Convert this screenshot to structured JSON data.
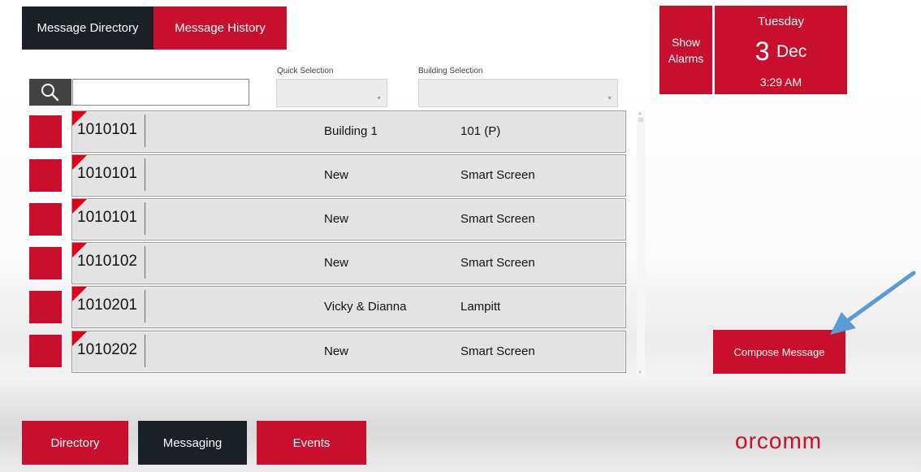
{
  "top_tabs": {
    "message_directory": "Message Directory",
    "message_history": "Message History"
  },
  "filters": {
    "quick_selection_label": "Quick Selection",
    "building_selection_label": "Building Selection",
    "search_value": ""
  },
  "rows": [
    {
      "id": "1010101",
      "col1": "Building 1",
      "col2": "101 (P)"
    },
    {
      "id": "1010101",
      "col1": "New",
      "col2": "Smart Screen"
    },
    {
      "id": "1010101",
      "col1": "New",
      "col2": "Smart Screen"
    },
    {
      "id": "1010102",
      "col1": "New",
      "col2": "Smart Screen"
    },
    {
      "id": "1010201",
      "col1": "Vicky & Dianna",
      "col2": "Lampitt"
    },
    {
      "id": "1010202",
      "col1": "New",
      "col2": "Smart Screen"
    }
  ],
  "alarms": {
    "line1": "Show",
    "line2": "Alarms"
  },
  "date": {
    "weekday": "Tuesday",
    "day": "3",
    "month": "Dec",
    "time": "3:29 AM"
  },
  "compose_label": "Compose Message",
  "bottom_tabs": {
    "directory": "Directory",
    "messaging": "Messaging",
    "events": "Events"
  },
  "logo_text": "orcomm",
  "colors": {
    "brand_red": "#c8102e",
    "dark": "#1b1f26",
    "annotation_arrow": "#5b9bd5"
  }
}
